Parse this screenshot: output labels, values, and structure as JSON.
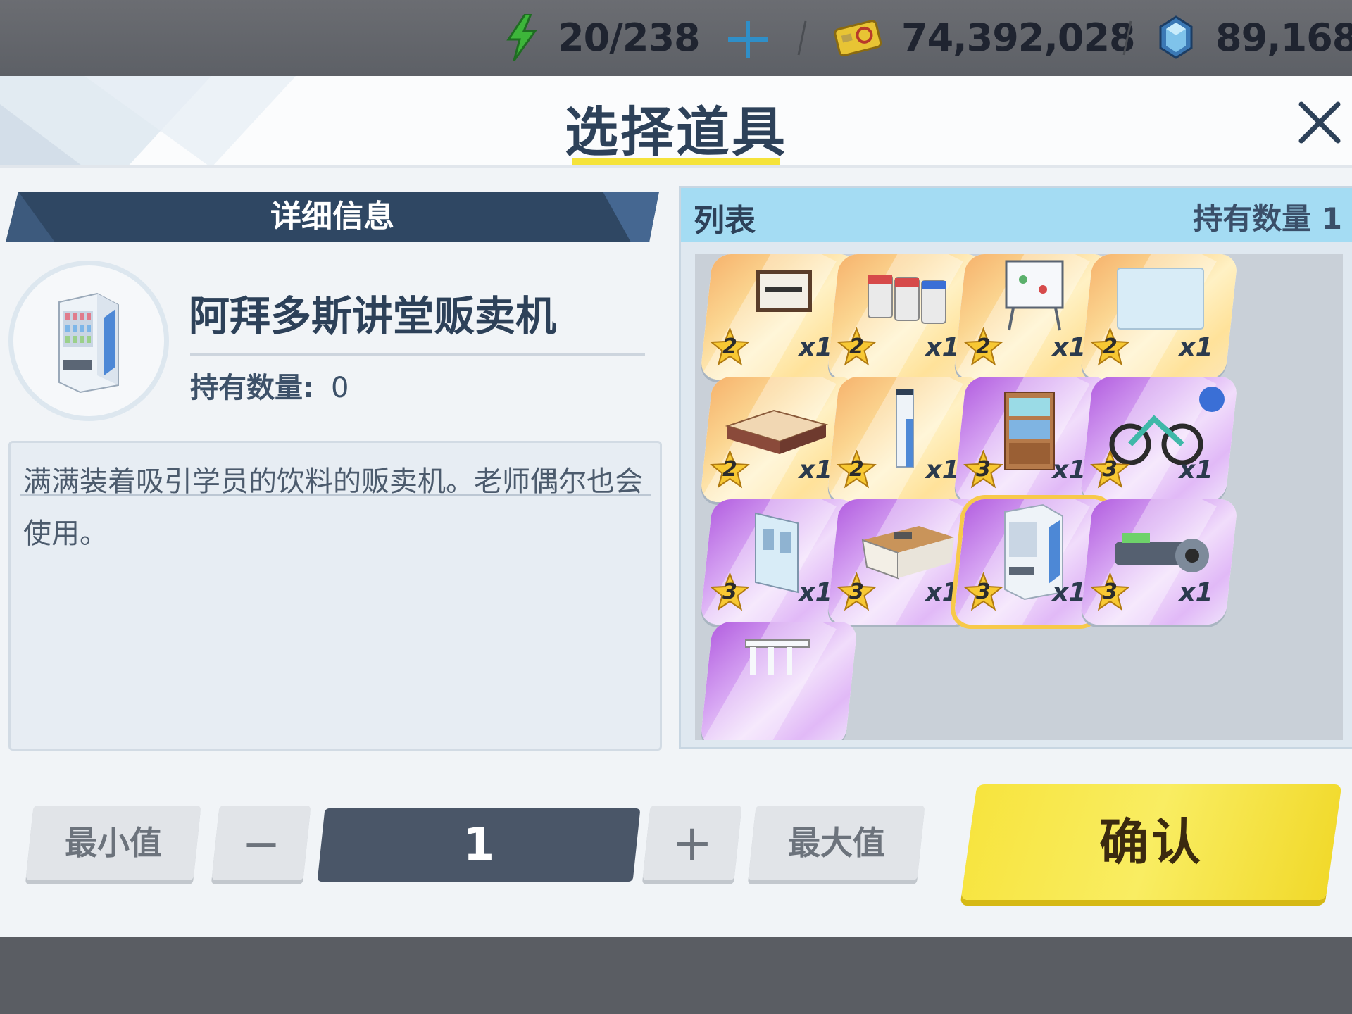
{
  "resources": {
    "ap": "20/238",
    "credits": "74,392,028",
    "gems": "89,168"
  },
  "dialog": {
    "title": "选择道具",
    "close_icon": "close-icon"
  },
  "detail": {
    "section_label": "详细信息",
    "item_name": "阿拜多斯讲堂贩卖机",
    "owned_label": "持有数量:",
    "owned_value": "0",
    "description": "满满装着吸引学员的饮料的贩卖机。老师偶尔也会使用。"
  },
  "list": {
    "title": "列表",
    "owned_count_label": "持有数量 1",
    "items": [
      {
        "icon": "motivation-sign-icon",
        "rarity": "2",
        "qty": "x1"
      },
      {
        "icon": "recycle-bins-icon",
        "rarity": "2",
        "qty": "x1"
      },
      {
        "icon": "whiteboard-icon",
        "rarity": "2",
        "qty": "x1"
      },
      {
        "icon": "wall-panel-icon",
        "rarity": "2",
        "qty": "x1"
      },
      {
        "icon": "floor-mat-icon",
        "rarity": "2",
        "qty": "x1"
      },
      {
        "icon": "pillar-icon",
        "rarity": "2",
        "qty": "x1"
      },
      {
        "icon": "bookshelf-icon",
        "rarity": "3",
        "qty": "x1"
      },
      {
        "icon": "exercise-bike-icon",
        "rarity": "3",
        "qty": "x1"
      },
      {
        "icon": "sliding-door-icon",
        "rarity": "3",
        "qty": "x1"
      },
      {
        "icon": "desk-icon",
        "rarity": "3",
        "qty": "x1"
      },
      {
        "icon": "vending-machine-icon",
        "rarity": "3",
        "qty": "x1"
      },
      {
        "icon": "machine-gun-icon",
        "rarity": "3",
        "qty": "x1"
      },
      {
        "icon": "railing-icon",
        "rarity": "",
        "qty": ""
      }
    ],
    "selected_index": 10
  },
  "controls": {
    "min_label": "最小值",
    "minus_label": "—",
    "quantity": "1",
    "plus_label": "+",
    "max_label": "最大值",
    "confirm_label": "确认"
  },
  "colors": {
    "accent_yellow": "#f5e33a",
    "header_navy": "#2f4763",
    "list_header": "#a4dcf3",
    "rarity2": "#fbd590",
    "rarity3": "#d7a6f3"
  }
}
